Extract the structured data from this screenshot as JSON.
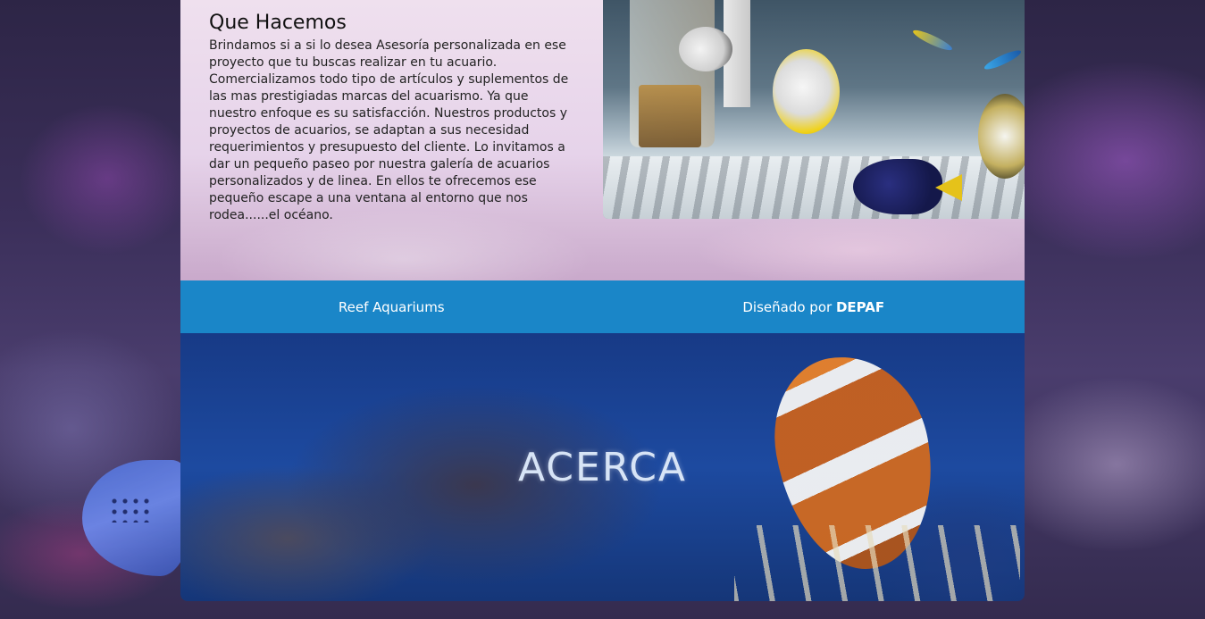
{
  "hacemos": {
    "title": "Que Hacemos",
    "body": "Brindamos si a si lo desea Asesoría personalizada en ese proyecto que tu buscas realizar en tu acuario. Comercializamos todo tipo de artículos y suplementos de las mas prestigiadas marcas del acuarismo. Ya que nuestro enfoque es su satisfacción. Nuestros productos y proyectos de acuarios, se adaptan a sus necesidad requerimientos y presupuesto del cliente. Lo invitamos a dar un pequeño paseo por nuestra galería de acuarios personalizados y de linea. En ellos te ofrecemos ese pequeño escape a una ventana al entorno que nos rodea......el océano."
  },
  "footer": {
    "site_name": "Reef Aquariums",
    "designed_by_prefix": "Diseñado por",
    "designer": "DEPAF"
  },
  "acerca": {
    "title": "ACERCA"
  },
  "colors": {
    "footer_bg": "#1a86c8",
    "acerca_bg": "#1d4aa0"
  }
}
